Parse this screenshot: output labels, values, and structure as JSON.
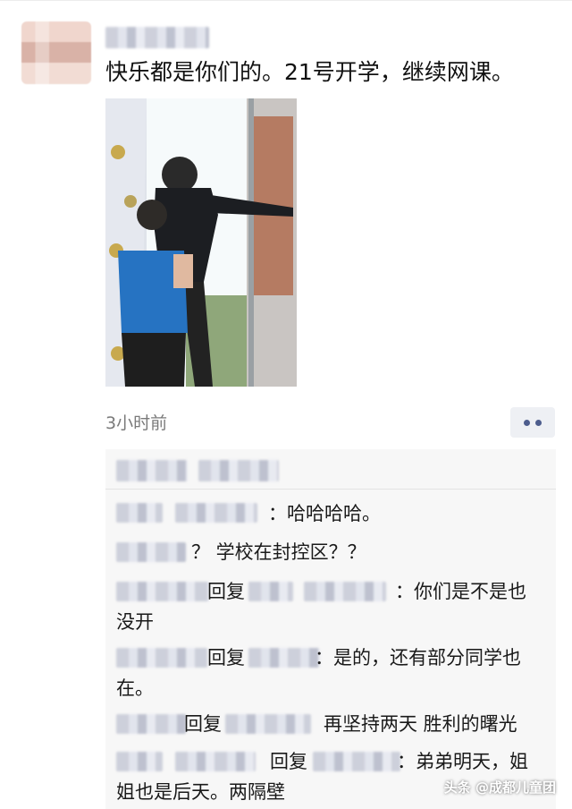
{
  "post": {
    "text": "快乐都是你们的。21号开学，继续网课。",
    "time": "3小时前"
  },
  "comments": [
    {
      "text": "：哈哈哈哈。"
    },
    {
      "text": "？ 学校在封控区？？"
    },
    {
      "reply_word": "回复",
      "text_line1": "：你们是不是也",
      "text_line2": "没开"
    },
    {
      "reply_word": "回复",
      "text_line1": "：是的，还有部分同学也",
      "text_line2": "在。"
    },
    {
      "reply_word": "回复",
      "text": "再坚持两天 胜利的曙光"
    },
    {
      "reply_word": "回复",
      "text_line1": "：弟弟明天，姐",
      "text_line2": "姐也是后天。两隔壁"
    }
  ],
  "watermark": "头条 @成都儿童团",
  "colors": {
    "panel_bg": "#f7f7f7",
    "more_dots": "#4d5d8d",
    "time_text": "#7a7a7a"
  }
}
